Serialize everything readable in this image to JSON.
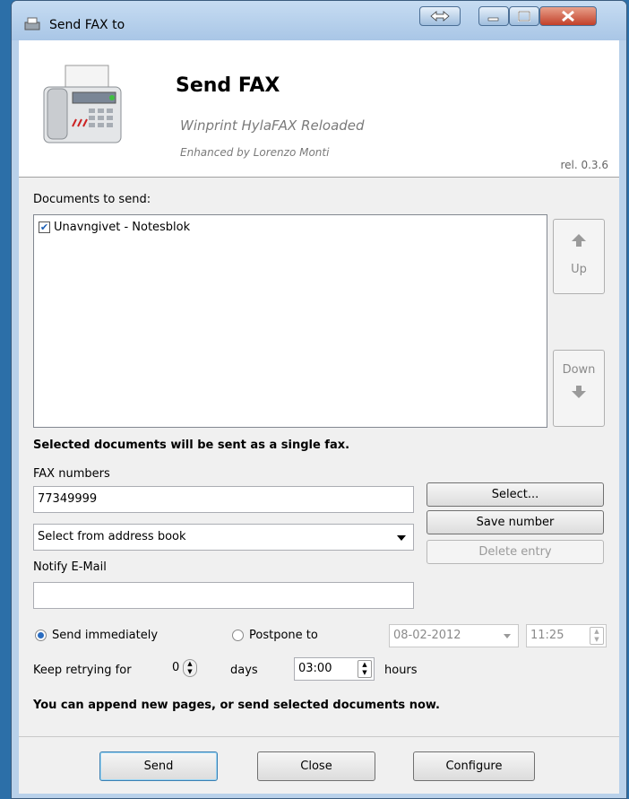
{
  "window": {
    "title": "Send FAX to"
  },
  "header": {
    "title": "Send FAX",
    "subtitle": "Winprint HylaFAX Reloaded",
    "credit": "Enhanced by Lorenzo Monti",
    "release": "rel. 0.3.6"
  },
  "documents": {
    "label": "Documents to send:",
    "items": [
      {
        "name": "Unavngivet - Notesblok",
        "checked": true
      }
    ],
    "up_label": "Up",
    "down_label": "Down"
  },
  "info_single_fax": "Selected documents will be sent as a single fax.",
  "fax": {
    "label": "FAX numbers",
    "value": "77349999",
    "select_button": "Select...",
    "save_button": "Save number",
    "delete_button": "Delete entry",
    "addressbook_selected": "Select from address book"
  },
  "notify": {
    "label": "Notify E-Mail",
    "value": ""
  },
  "schedule": {
    "send_immediately": "Send immediately",
    "postpone": "Postpone to",
    "date": "08-02-2012",
    "time": "11:25",
    "selected": "send_immediately"
  },
  "retry": {
    "label": "Keep retrying for",
    "days_value": "0",
    "days_label": "days",
    "hours_value": "03:00",
    "hours_label": "hours"
  },
  "info_append": "You can append new pages, or send selected documents now.",
  "footer": {
    "send": "Send",
    "close": "Close",
    "configure": "Configure"
  }
}
